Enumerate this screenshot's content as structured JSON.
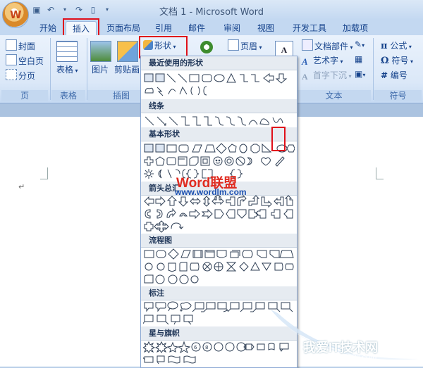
{
  "window": {
    "title": "文档 1 - Microsoft Word"
  },
  "tabs": [
    "开始",
    "插入",
    "页面布局",
    "引用",
    "邮件",
    "审阅",
    "视图",
    "开发工具",
    "加载项"
  ],
  "ribbon": {
    "pages": {
      "cover": "封面",
      "blank": "空白页",
      "break": "分页",
      "label": "页"
    },
    "table": {
      "button": "表格",
      "label": "表格"
    },
    "illustrations": {
      "picture": "图片",
      "clipart": "剪贴画",
      "shapes": "形状",
      "label": "插图"
    },
    "header": {
      "button": "页眉"
    },
    "text": {
      "quickparts": "文档部件",
      "wordart": "艺术字",
      "dropcap": "首字下沉",
      "label": "文本"
    },
    "symbols": {
      "equation": "公式",
      "symbol": "符号",
      "number": "编号",
      "label": "符号"
    }
  },
  "shapes_menu": {
    "sections": [
      "最近使用的形状",
      "线条",
      "基本形状",
      "箭头总汇",
      "流程图",
      "标注",
      "星与旗帜"
    ]
  },
  "watermarks": {
    "site1_a": "Word",
    "site1_b": "联盟",
    "site1_url": "www.wordlm.com",
    "site2": "我爱IT技术网",
    "site2_url": "www.52ij.com"
  },
  "colors": {
    "highlight": "#e0101a",
    "ribbon": "#dbe8f8",
    "accent": "#15428b"
  }
}
